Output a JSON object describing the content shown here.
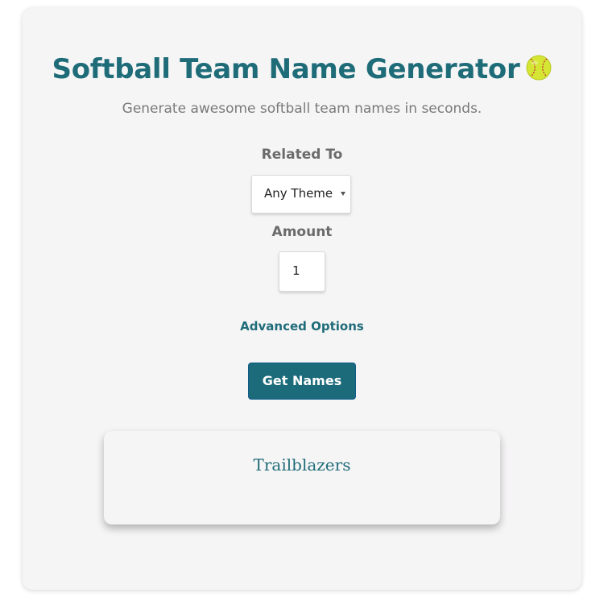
{
  "header": {
    "title": "Softball Team Name Generator",
    "title_icon": "softball-icon",
    "subtitle": "Generate awesome softball team names in seconds."
  },
  "form": {
    "related_label": "Related To",
    "related_value": "Any Theme (",
    "amount_label": "Amount",
    "amount_value": "1",
    "advanced_label": "Advanced Options",
    "submit_label": "Get Names"
  },
  "results": {
    "names": [
      "Trailblazers"
    ]
  },
  "colors": {
    "accent": "#1f6c79",
    "button": "#1b6b7b",
    "card_bg": "#f6f5f6",
    "softball": "#d4e534"
  }
}
